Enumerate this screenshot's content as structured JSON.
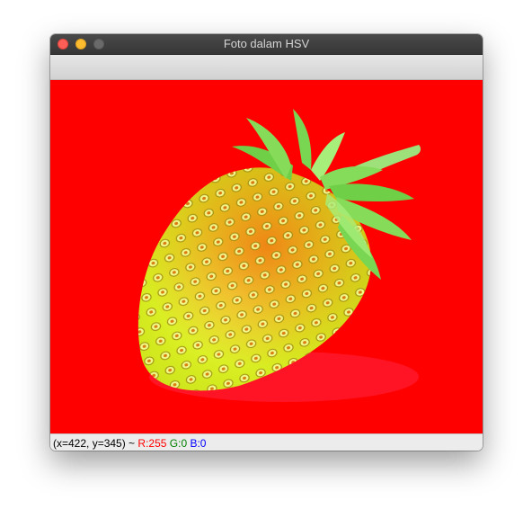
{
  "window": {
    "title": "Foto dalam HSV"
  },
  "image": {
    "subject": "strawberry",
    "colors": {
      "background": "#ff0000",
      "body": "#e4f020",
      "shade": "#ef8a16",
      "seed": "#f6ff9a",
      "leaf": "#78d652",
      "leaf_light": "#a8ee7a"
    }
  },
  "status": {
    "coords": "(x=422, y=345) ~",
    "r": "R:255",
    "g": "G:0",
    "b": "B:0"
  }
}
